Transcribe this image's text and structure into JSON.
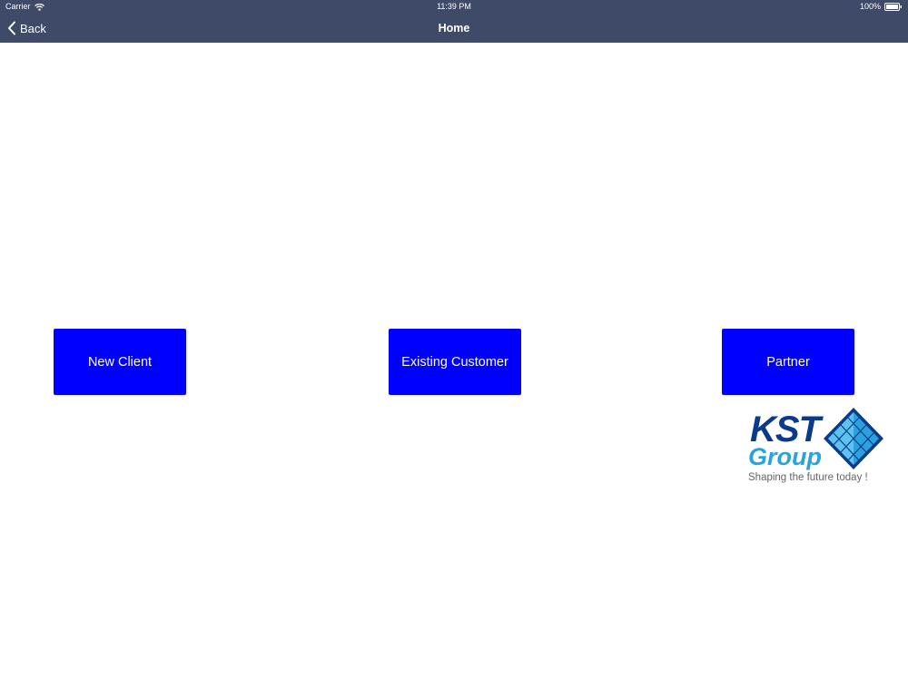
{
  "status_bar": {
    "carrier": "Carrier",
    "time": "11:39 PM",
    "battery_percent": "100%",
    "battery_level": 1.0
  },
  "nav": {
    "back_label": "Back",
    "title": "Home"
  },
  "buttons": {
    "new_client": "New Client",
    "existing_customer": "Existing Customer",
    "partner": "Partner"
  },
  "logo": {
    "line1": "KST",
    "line2": "Group",
    "tagline": "Shaping the future today !"
  },
  "colors": {
    "nav_background": "#3e4a68",
    "button_background": "#0000ff",
    "button_text": "#ffffff",
    "logo_dark_blue": "#0a3a8c",
    "logo_light_blue": "#2aa3dc",
    "logo_tagline": "#666666"
  },
  "icons": {
    "wifi": "wifi-icon",
    "battery": "battery-icon",
    "back": "chevron-left-icon",
    "logo_mark": "pyramid-logo-icon"
  }
}
